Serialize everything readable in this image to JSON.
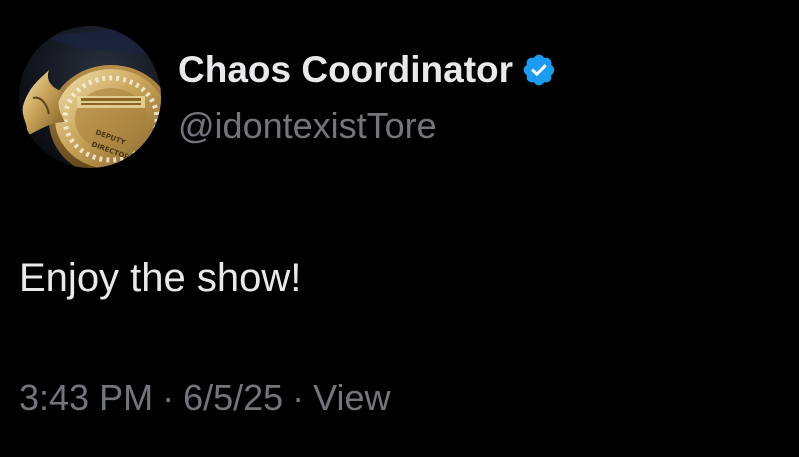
{
  "author": {
    "display_name": "Chaos Coordinator",
    "handle": "@idontexistTore",
    "verified": true,
    "verified_icon": "verified-badge-icon",
    "verified_color": "#1d9bf0",
    "avatar_icon": "gold-badge-avatar-image",
    "avatar_badge_text": [
      "DEPUTY",
      "DIRECTOR"
    ]
  },
  "tweet": {
    "text": "Enjoy the show!"
  },
  "meta": {
    "time": "3:43 PM",
    "separator": "·",
    "date": "6/5/25",
    "views_label": "View"
  },
  "colors": {
    "background": "#000000",
    "primary_text": "#e7e9ea",
    "secondary_text": "#71767b"
  }
}
